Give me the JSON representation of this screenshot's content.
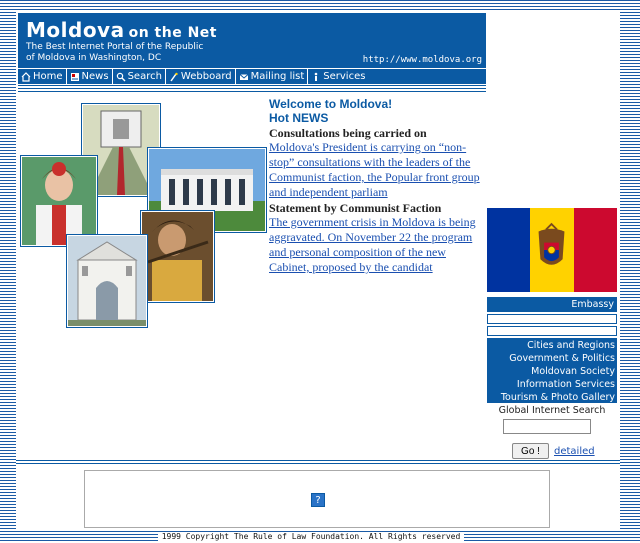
{
  "header": {
    "logo_main": "Moldova",
    "logo_small": "on the Net",
    "subtitle_line1": "The Best Internet Portal of the Republic",
    "subtitle_line2": "of Moldova  in  Washington, DC",
    "url": "http://www.moldova.org"
  },
  "nav": {
    "items": [
      {
        "label": "Home",
        "icon": "home-icon"
      },
      {
        "label": "News",
        "icon": "newspaper-icon"
      },
      {
        "label": "Search",
        "icon": "search-icon"
      },
      {
        "label": "Webboard",
        "icon": "webboard-icon"
      },
      {
        "label": "Mailing list",
        "icon": "mail-icon"
      },
      {
        "label": "Services",
        "icon": "info-icon"
      }
    ]
  },
  "news": {
    "welcome": "Welcome to Moldova!",
    "hot": "Hot NEWS",
    "stories": [
      {
        "headline": "Consultations being carried on",
        "text": "Moldova's President is carrying on “non-stop” consultations with the leaders of the Communist faction, the Popular front group and independent parliam"
      },
      {
        "headline": "Statement by Communist Faction",
        "text": "The government crisis in Moldova is being aggravated. On November 22 the program and personal composition of the new Cabinet, proposed by the candidat"
      }
    ]
  },
  "sidebar": {
    "embassy": "Embassy",
    "menu": [
      "Cities and Regions",
      "Government & Politics",
      "Moldovan Society",
      "Information Services",
      "Tourism & Photo Gallery"
    ],
    "search_label": "Global Internet Search",
    "search_value": "",
    "go_label": "Go !",
    "detailed_label": "detailed"
  },
  "footer": {
    "ad_icon": "?",
    "copyright": "1999 Copyright  The Rule of Law Foundation.  All Rights reserved"
  },
  "colors": {
    "brand_blue": "#0b5aa3",
    "flag_blue": "#0033a0",
    "flag_yellow": "#ffd200",
    "flag_red": "#cc092f"
  }
}
